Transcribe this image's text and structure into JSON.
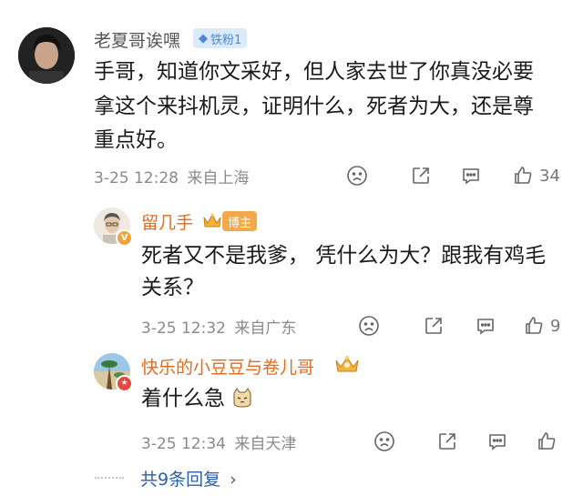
{
  "comment": {
    "username": "老夏哥诶嘿",
    "fan_badge": "铁粉1",
    "text_lines": [
      "手哥，知道你文采好，但人家去世了你真没必要",
      "拿这个来抖机灵，证明什么，死者为大，还是尊",
      "重点好。"
    ],
    "time": "3-25 12:28",
    "location": "来自上海",
    "like_count": "34"
  },
  "replies": [
    {
      "username": "留几手",
      "badge": "博主",
      "text_lines": [
        "死者又不是我爹， 凭什么为大？跟我有鸡毛",
        "关系？"
      ],
      "time": "3-25 12:32",
      "location": "来自广东",
      "like_count": "9"
    },
    {
      "username": "快乐的小豆豆与卷儿哥",
      "text_lines": [
        "着什么急"
      ],
      "time": "3-25 12:34",
      "location": "来自天津",
      "like_count": ""
    }
  ],
  "more_replies_label": "共9条回复",
  "colors": {
    "reply_name": "#e56a1a",
    "link": "#2b5fad",
    "blogger_badge": "#f2a94a"
  }
}
